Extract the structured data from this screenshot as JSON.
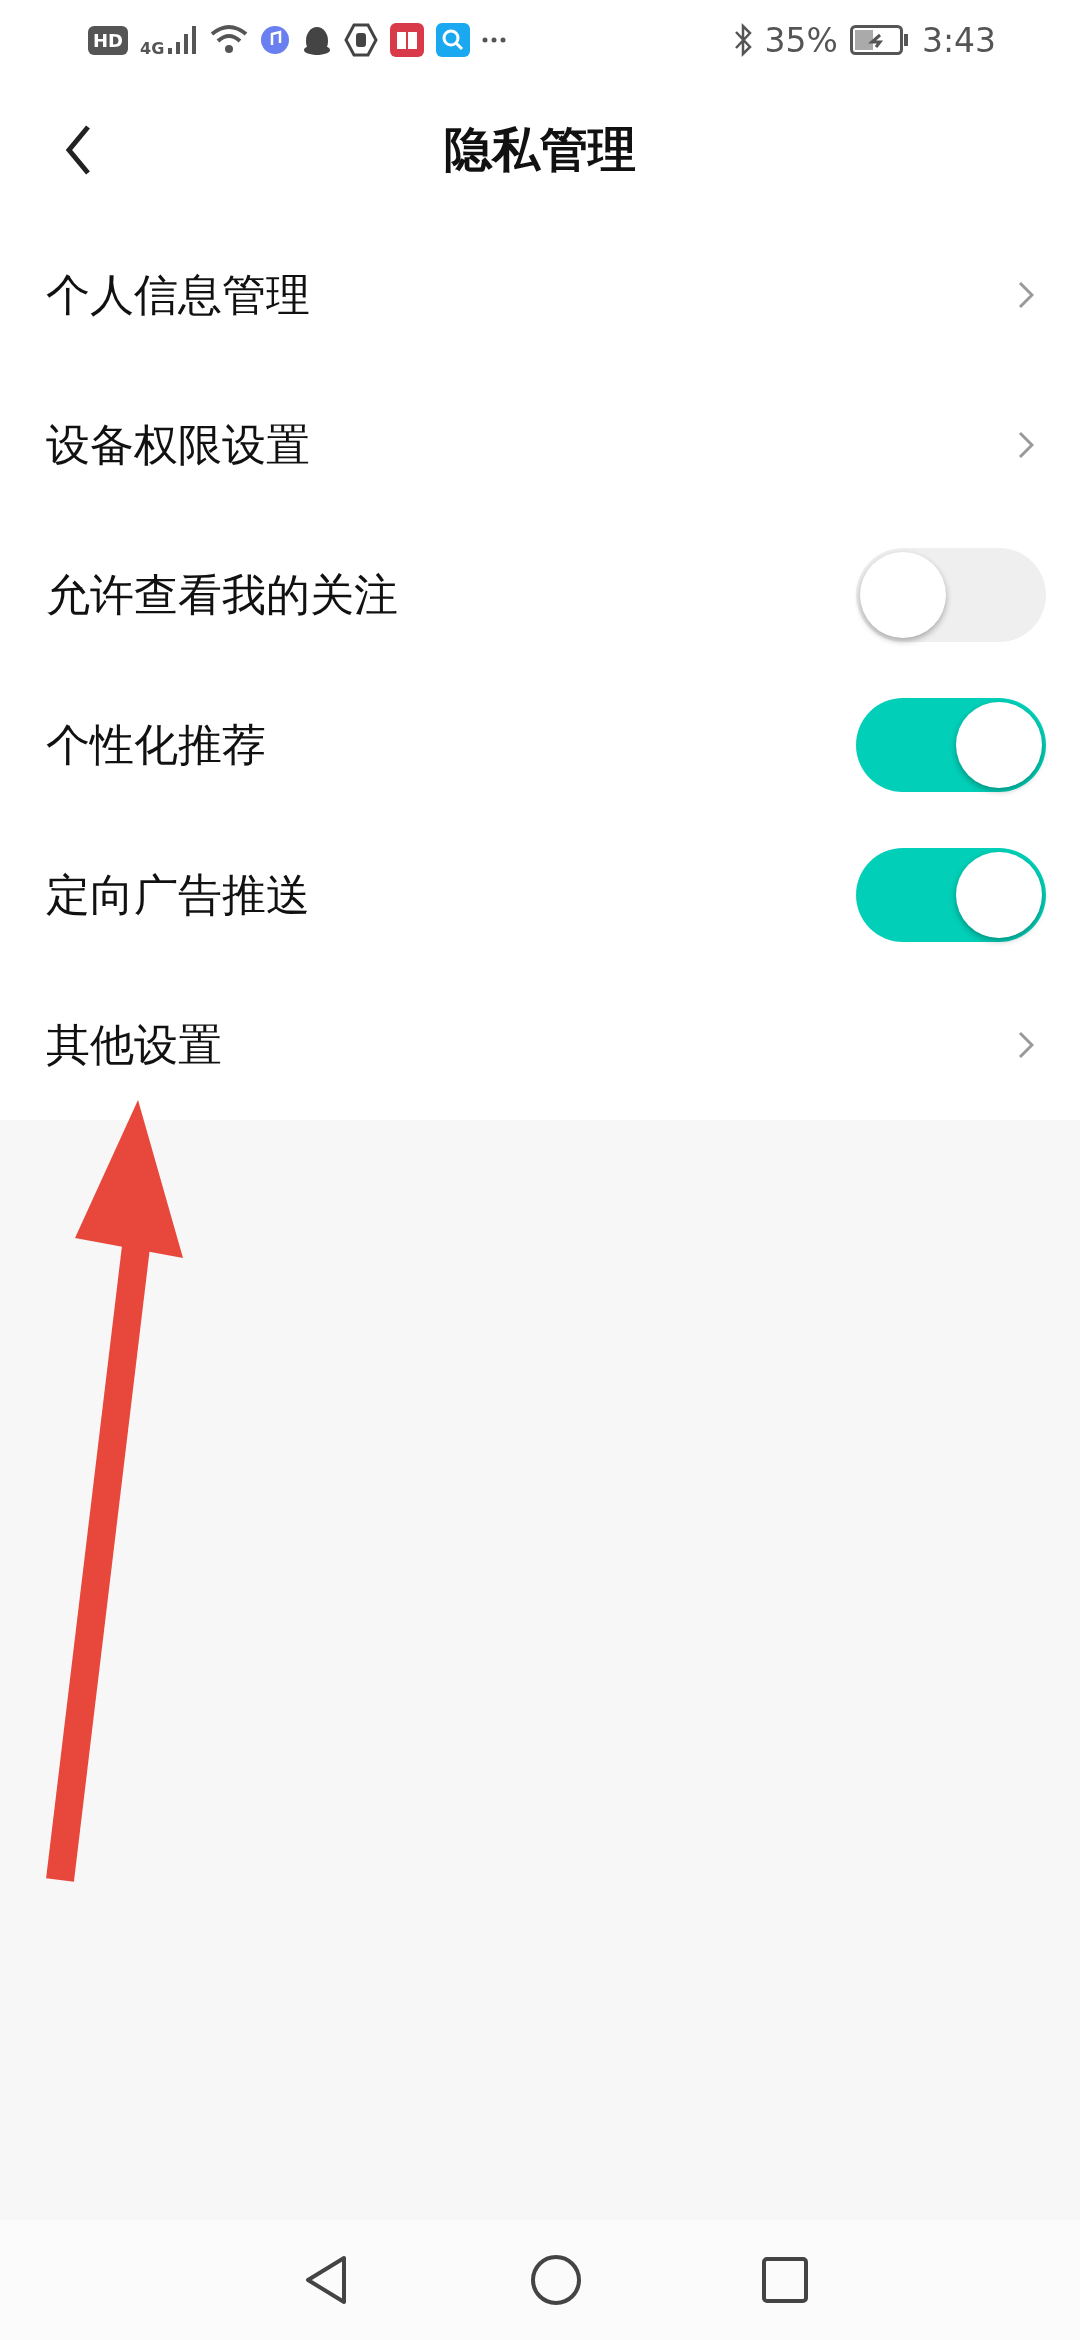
{
  "status_bar": {
    "hd": "HD",
    "network": "4G",
    "battery": "35%",
    "time": "3:43"
  },
  "header": {
    "title": "隐私管理"
  },
  "items": [
    {
      "kind": "link",
      "label": "个人信息管理"
    },
    {
      "kind": "link",
      "label": "设备权限设置"
    },
    {
      "kind": "toggle",
      "label": "允许查看我的关注",
      "on": false
    },
    {
      "kind": "toggle",
      "label": "个性化推荐",
      "on": true
    },
    {
      "kind": "toggle",
      "label": "定向广告推送",
      "on": true
    },
    {
      "kind": "link",
      "label": "其他设置"
    }
  ]
}
